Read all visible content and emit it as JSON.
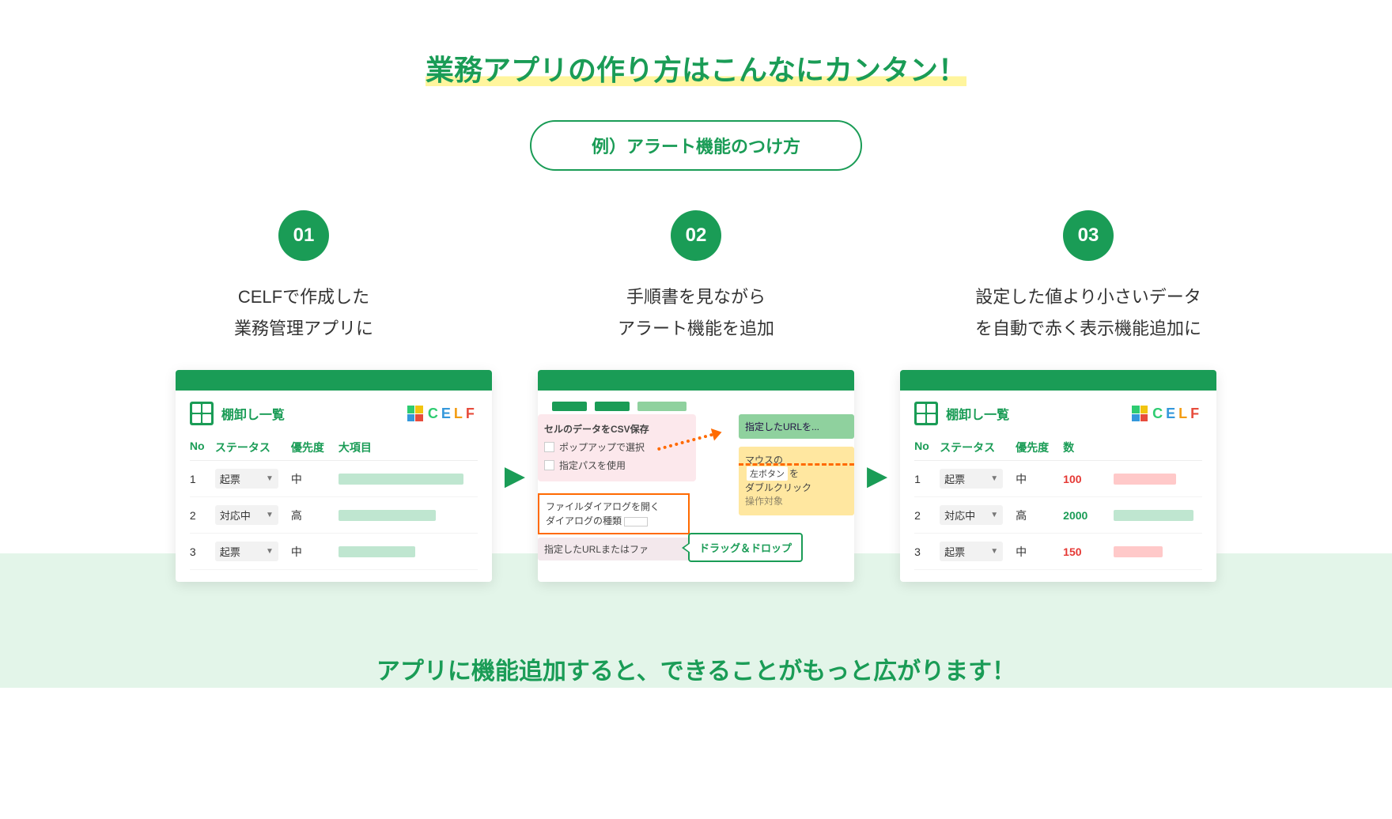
{
  "title": "業務アプリの作り方はこんなにカンタン！",
  "example_label": "例）アラート機能のつけ方",
  "steps": [
    {
      "num": "01",
      "line1": "CELFで作成した",
      "line2": "業務管理アプリに"
    },
    {
      "num": "02",
      "line1": "手順書を見ながら",
      "line2": "アラート機能を追加"
    },
    {
      "num": "03",
      "line1": "設定した値より小さいデータ",
      "line2": "を自動で赤く表示機能追加に"
    }
  ],
  "card1": {
    "app_title": "棚卸し一覧",
    "logo": "CELF",
    "headers": {
      "no": "No",
      "status": "ステータス",
      "priority": "優先度",
      "major": "大項目"
    },
    "rows": [
      {
        "no": "1",
        "status": "起票",
        "priority": "中"
      },
      {
        "no": "2",
        "status": "対応中",
        "priority": "高"
      },
      {
        "no": "3",
        "status": "起票",
        "priority": "中"
      }
    ]
  },
  "card2": {
    "csv_title": "セルのデータをCSV保存",
    "opt_popup": "ポップアップで選択",
    "opt_path": "指定パスを使用",
    "url_block": "指定したURLを...",
    "mouse_l1": "マウスの",
    "mouse_btn": "左ボタン",
    "mouse_wo": "を",
    "mouse_l3": "ダブルクリック",
    "mouse_l4": "操作対象",
    "file_l1": "ファイルダイアログを開く",
    "file_l2": "ダイアログの種類",
    "url_note": "指定したURLまたはファ",
    "dnd": "ドラッグ＆ドロップ"
  },
  "card3": {
    "app_title": "棚卸し一覧",
    "logo": "CELF",
    "headers": {
      "no": "No",
      "status": "ステータス",
      "priority": "優先度",
      "count": "数"
    },
    "rows": [
      {
        "no": "1",
        "status": "起票",
        "priority": "中",
        "num": "100",
        "numClass": "num-red",
        "barClass": "bar-red",
        "barW": "70%"
      },
      {
        "no": "2",
        "status": "対応中",
        "priority": "高",
        "num": "2000",
        "numClass": "num-green",
        "barClass": "bar-green",
        "barW": "90%"
      },
      {
        "no": "3",
        "status": "起票",
        "priority": "中",
        "num": "150",
        "numClass": "num-red",
        "barClass": "bar-red",
        "barW": "55%"
      }
    ]
  },
  "footer": "アプリに機能追加すると、できることがもっと広がります！"
}
